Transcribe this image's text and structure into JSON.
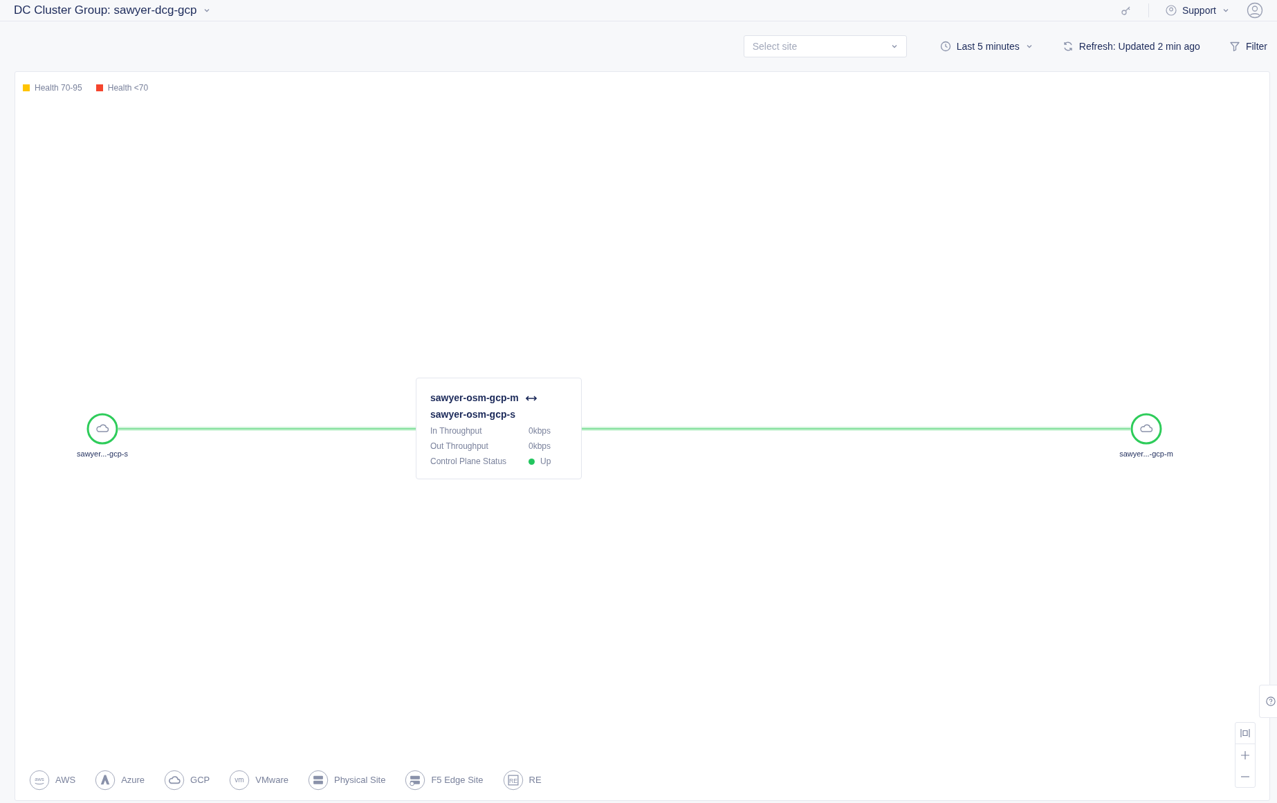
{
  "header": {
    "title": "DC Cluster Group: sawyer-dcg-gcp",
    "support": "Support"
  },
  "toolbar": {
    "site_select": {
      "placeholder": "Select site"
    },
    "time_range": "Last 5 minutes",
    "refresh": "Refresh: Updated 2 min ago",
    "filter": "Filter"
  },
  "health_legend": [
    {
      "label": "Health 70-95",
      "color": "#ffc400"
    },
    {
      "label": "Health <70",
      "color": "#f5452d"
    }
  ],
  "topology": {
    "nodes": [
      {
        "label": "sawyer...-gcp-s"
      },
      {
        "label": "sawyer...-gcp-m"
      }
    ],
    "link_tooltip": {
      "from": "sawyer-osm-gcp-m",
      "to": "sawyer-osm-gcp-s",
      "rows": [
        {
          "label": "In Throughput",
          "value": "0kbps"
        },
        {
          "label": "Out Throughput",
          "value": "0kbps"
        },
        {
          "label": "Control Plane Status",
          "value": "Up",
          "color": "#22c55e"
        }
      ]
    }
  },
  "provider_legend": [
    {
      "kind": "aws",
      "badge": "aws",
      "label": "AWS"
    },
    {
      "kind": "azure",
      "label": "Azure"
    },
    {
      "kind": "gcp",
      "label": "GCP"
    },
    {
      "kind": "vmware",
      "badge": "vm",
      "label": "VMware"
    },
    {
      "kind": "physical",
      "label": "Physical Site"
    },
    {
      "kind": "f5",
      "label": "F5 Edge Site"
    },
    {
      "kind": "re",
      "badge": "RE",
      "label": "RE"
    }
  ]
}
